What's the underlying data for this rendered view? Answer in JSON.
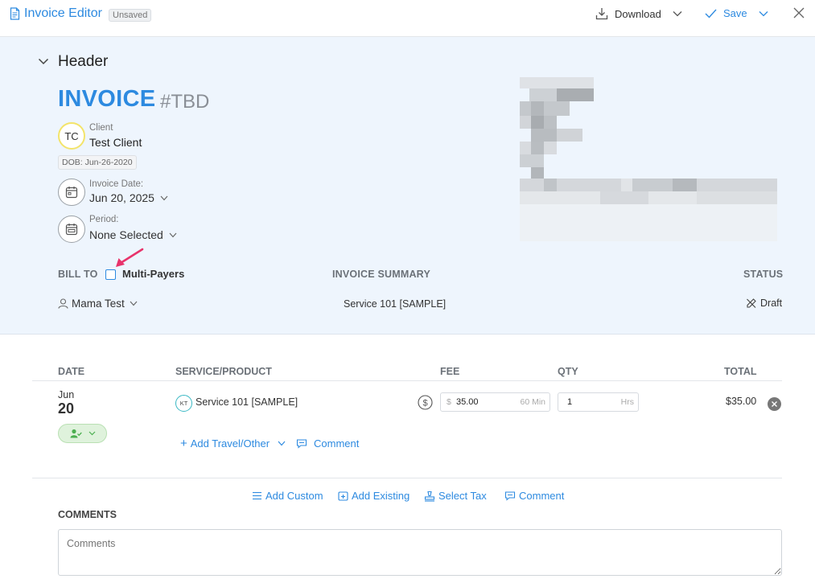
{
  "window": {
    "title": "Invoice Editor",
    "status_badge": "Unsaved",
    "download_label": "Download",
    "save_label": "Save"
  },
  "header": {
    "section_title": "Header",
    "invoice_label": "INVOICE",
    "invoice_number": "#TBD",
    "client": {
      "initials": "TC",
      "label": "Client",
      "name": "Test Client",
      "dob": "DOB: Jun-26-2020"
    },
    "invoice_date": {
      "label": "Invoice Date:",
      "value": "Jun 20, 2025"
    },
    "period": {
      "label": "Period:",
      "value": "None Selected"
    },
    "bill_to_label": "BILL TO",
    "multi_payers_label": "Multi-Payers",
    "multi_payers_checked": false,
    "invoice_summary_label": "INVOICE SUMMARY",
    "status_label": "STATUS",
    "payer": "Mama Test",
    "summary_value": "Service 101 [SAMPLE]",
    "status_value": "Draft"
  },
  "line_items": {
    "columns": {
      "date": "DATE",
      "service": "SERVICE/PRODUCT",
      "fee": "FEE",
      "qty": "QTY",
      "total": "TOTAL"
    },
    "rows": [
      {
        "month": "Jun",
        "day": "20",
        "provider_initials": "KT",
        "service": "Service 101 [SAMPLE]",
        "fee_currency": "$",
        "fee_value": "35.00",
        "fee_unit": "60 Min",
        "qty_value": "1",
        "qty_unit": "Hrs",
        "total": "$35.00"
      }
    ],
    "add_travel_label": "Add Travel/Other",
    "row_comment_label": "Comment"
  },
  "footer_actions": {
    "add_custom": "Add Custom",
    "add_existing": "Add Existing",
    "select_tax": "Select Tax",
    "comment": "Comment"
  },
  "comments": {
    "heading": "COMMENTS",
    "placeholder": "Comments"
  },
  "colors": {
    "accent": "#2d8ae0",
    "header_bg": "#eef5fd",
    "annotation_arrow": "#e8336b"
  }
}
